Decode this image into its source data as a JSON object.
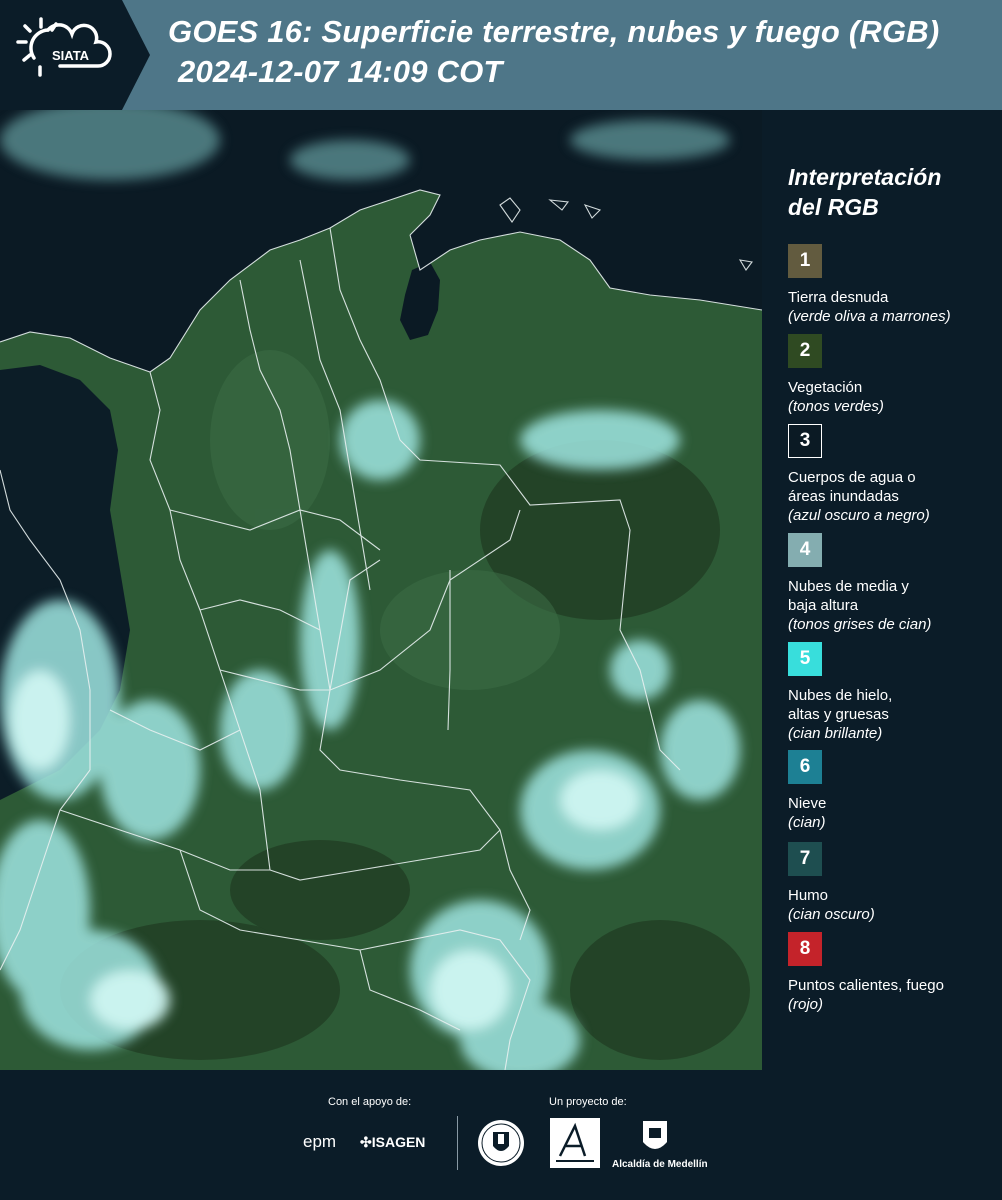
{
  "header": {
    "logo_text": "SIATA",
    "title_line1": "GOES 16: Superficie terrestre, nubes y fuego (RGB)",
    "title_line2": "2024-12-07 14:09 COT"
  },
  "legend": {
    "title_line1": "Interpretación",
    "title_line2": "del RGB",
    "items": [
      {
        "number": "1",
        "color": "#625b3f",
        "label": "Tierra desnuda",
        "note": "(verde oliva a marrones)"
      },
      {
        "number": "2",
        "color": "#2f4a22",
        "label": "Vegetación",
        "note": "(tonos verdes)"
      },
      {
        "number": "3",
        "color": "#0b1a24",
        "label": "Cuerpos de agua o áreas inundadas",
        "note": "(azul oscuro a negro)"
      },
      {
        "number": "4",
        "color": "#84adb0",
        "label": "Nubes de media y baja altura",
        "note": "(tonos grises de cian)"
      },
      {
        "number": "5",
        "color": "#38dedc",
        "label": "Nubes de hielo, altas y gruesas",
        "note": "(cian brillante)"
      },
      {
        "number": "6",
        "color": "#1d8094",
        "label": "Nieve",
        "note": "(cian)"
      },
      {
        "number": "7",
        "color": "#1e4e50",
        "label": "Humo",
        "note": "(cian oscuro)"
      },
      {
        "number": "8",
        "color": "#c4232a",
        "label": "Puntos calientes, fuego",
        "note": "(rojo)"
      }
    ]
  },
  "footer": {
    "support_label": "Con el apoyo de:",
    "project_label": "Un proyecto de:",
    "sponsors": [
      "epm",
      "ISAGEN"
    ],
    "partners": [
      "Área Metropolitana",
      "Alcaldía de Medellín"
    ],
    "alcaldia_text": "Alcaldía de Medellín"
  },
  "map": {
    "colors": {
      "ocean": "#0b1a24",
      "land": "#2d5a36",
      "land_dark": "#234a2c",
      "cloud": "#9fe6e2",
      "cloud_bright": "#c8f5f2",
      "border": "#e8f0f0"
    }
  }
}
